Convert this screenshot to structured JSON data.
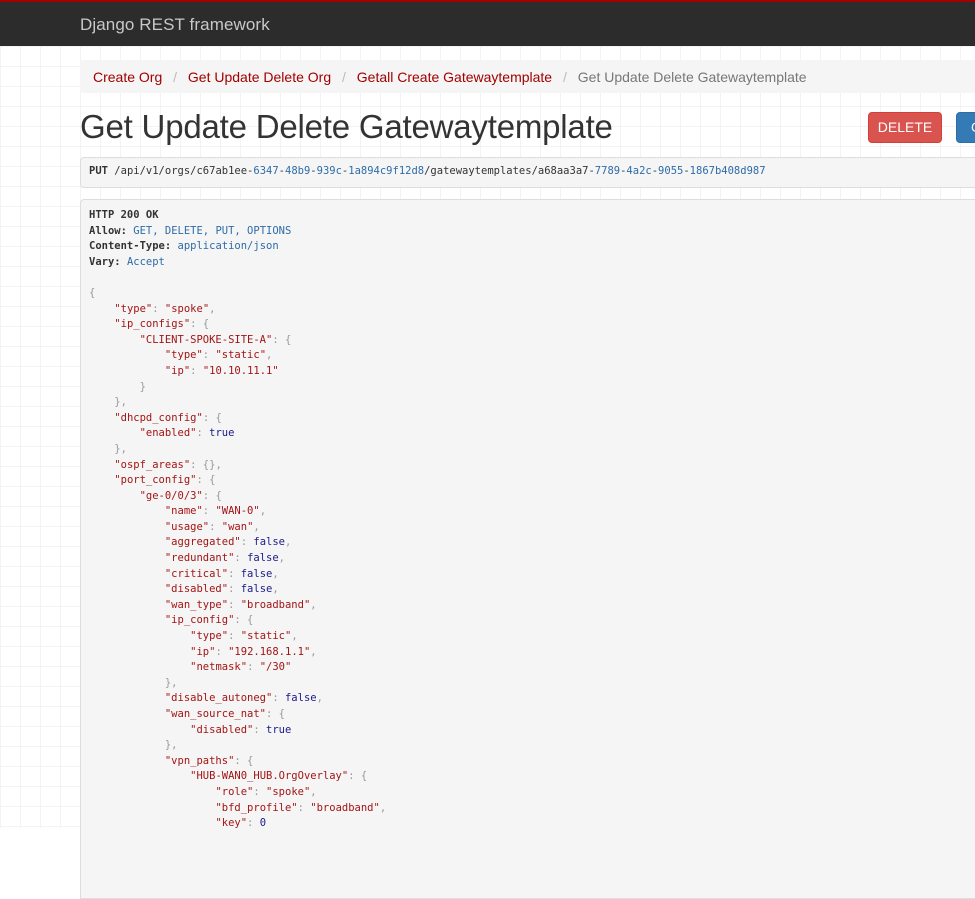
{
  "navbar": {
    "brand": "Django REST framework"
  },
  "breadcrumb": {
    "items": [
      "Create Org",
      "Get Update Delete Org",
      "Getall Create Gatewaytemplate"
    ],
    "active": "Get Update Delete Gatewaytemplate",
    "separator": "/"
  },
  "page": {
    "title": "Get Update Delete Gatewaytemplate"
  },
  "buttons": {
    "delete": "DELETE",
    "options": "O"
  },
  "request": {
    "method": "PUT",
    "path_parts": [
      {
        "t": "/api/v1/orgs/c67ab1ee-",
        "n": false
      },
      {
        "t": "6347",
        "n": true
      },
      {
        "t": "-",
        "n": false
      },
      {
        "t": "48b9",
        "n": true
      },
      {
        "t": "-",
        "n": false
      },
      {
        "t": "939c",
        "n": true
      },
      {
        "t": "-",
        "n": false
      },
      {
        "t": "1a894c9f12d8",
        "n": true
      },
      {
        "t": "/gatewaytemplates/a68aa3a7-",
        "n": false
      },
      {
        "t": "7789",
        "n": true
      },
      {
        "t": "-",
        "n": false
      },
      {
        "t": "4a2c",
        "n": true
      },
      {
        "t": "-",
        "n": false
      },
      {
        "t": "9055",
        "n": true
      },
      {
        "t": "-",
        "n": false
      },
      {
        "t": "1867b408d987",
        "n": true
      }
    ]
  },
  "response": {
    "status": "HTTP 200 OK",
    "headers": [
      {
        "name": "Allow",
        "value": "GET, DELETE, PUT, OPTIONS"
      },
      {
        "name": "Content-Type",
        "value": "application/json"
      },
      {
        "name": "Vary",
        "value": "Accept"
      }
    ],
    "body": [
      {
        "i": 0,
        "t": [
          [
            "p",
            "{"
          ]
        ]
      },
      {
        "i": 1,
        "t": [
          [
            "k",
            "\"type\""
          ],
          [
            "p",
            ": "
          ],
          [
            "s",
            "\"spoke\""
          ],
          [
            "p",
            ","
          ]
        ]
      },
      {
        "i": 1,
        "t": [
          [
            "k",
            "\"ip_configs\""
          ],
          [
            "p",
            ": {"
          ]
        ]
      },
      {
        "i": 2,
        "t": [
          [
            "k",
            "\"CLIENT-SPOKE-SITE-A\""
          ],
          [
            "p",
            ": {"
          ]
        ]
      },
      {
        "i": 3,
        "t": [
          [
            "k",
            "\"type\""
          ],
          [
            "p",
            ": "
          ],
          [
            "s",
            "\"static\""
          ],
          [
            "p",
            ","
          ]
        ]
      },
      {
        "i": 3,
        "t": [
          [
            "k",
            "\"ip\""
          ],
          [
            "p",
            ": "
          ],
          [
            "s",
            "\"10.10.11.1\""
          ]
        ]
      },
      {
        "i": 2,
        "t": [
          [
            "p",
            "}"
          ]
        ]
      },
      {
        "i": 1,
        "t": [
          [
            "p",
            "},"
          ]
        ]
      },
      {
        "i": 1,
        "t": [
          [
            "k",
            "\"dhcpd_config\""
          ],
          [
            "p",
            ": {"
          ]
        ]
      },
      {
        "i": 2,
        "t": [
          [
            "k",
            "\"enabled\""
          ],
          [
            "p",
            ": "
          ],
          [
            "l",
            "true"
          ]
        ]
      },
      {
        "i": 1,
        "t": [
          [
            "p",
            "},"
          ]
        ]
      },
      {
        "i": 1,
        "t": [
          [
            "k",
            "\"ospf_areas\""
          ],
          [
            "p",
            ": {},"
          ]
        ]
      },
      {
        "i": 1,
        "t": [
          [
            "k",
            "\"port_config\""
          ],
          [
            "p",
            ": {"
          ]
        ]
      },
      {
        "i": 2,
        "t": [
          [
            "k",
            "\"ge-0/0/3\""
          ],
          [
            "p",
            ": {"
          ]
        ]
      },
      {
        "i": 3,
        "t": [
          [
            "k",
            "\"name\""
          ],
          [
            "p",
            ": "
          ],
          [
            "s",
            "\"WAN-0\""
          ],
          [
            "p",
            ","
          ]
        ]
      },
      {
        "i": 3,
        "t": [
          [
            "k",
            "\"usage\""
          ],
          [
            "p",
            ": "
          ],
          [
            "s",
            "\"wan\""
          ],
          [
            "p",
            ","
          ]
        ]
      },
      {
        "i": 3,
        "t": [
          [
            "k",
            "\"aggregated\""
          ],
          [
            "p",
            ": "
          ],
          [
            "l",
            "false"
          ],
          [
            "p",
            ","
          ]
        ]
      },
      {
        "i": 3,
        "t": [
          [
            "k",
            "\"redundant\""
          ],
          [
            "p",
            ": "
          ],
          [
            "l",
            "false"
          ],
          [
            "p",
            ","
          ]
        ]
      },
      {
        "i": 3,
        "t": [
          [
            "k",
            "\"critical\""
          ],
          [
            "p",
            ": "
          ],
          [
            "l",
            "false"
          ],
          [
            "p",
            ","
          ]
        ]
      },
      {
        "i": 3,
        "t": [
          [
            "k",
            "\"disabled\""
          ],
          [
            "p",
            ": "
          ],
          [
            "l",
            "false"
          ],
          [
            "p",
            ","
          ]
        ]
      },
      {
        "i": 3,
        "t": [
          [
            "k",
            "\"wan_type\""
          ],
          [
            "p",
            ": "
          ],
          [
            "s",
            "\"broadband\""
          ],
          [
            "p",
            ","
          ]
        ]
      },
      {
        "i": 3,
        "t": [
          [
            "k",
            "\"ip_config\""
          ],
          [
            "p",
            ": {"
          ]
        ]
      },
      {
        "i": 4,
        "t": [
          [
            "k",
            "\"type\""
          ],
          [
            "p",
            ": "
          ],
          [
            "s",
            "\"static\""
          ],
          [
            "p",
            ","
          ]
        ]
      },
      {
        "i": 4,
        "t": [
          [
            "k",
            "\"ip\""
          ],
          [
            "p",
            ": "
          ],
          [
            "s",
            "\"192.168.1.1\""
          ],
          [
            "p",
            ","
          ]
        ]
      },
      {
        "i": 4,
        "t": [
          [
            "k",
            "\"netmask\""
          ],
          [
            "p",
            ": "
          ],
          [
            "s",
            "\"/30\""
          ]
        ]
      },
      {
        "i": 3,
        "t": [
          [
            "p",
            "},"
          ]
        ]
      },
      {
        "i": 3,
        "t": [
          [
            "k",
            "\"disable_autoneg\""
          ],
          [
            "p",
            ": "
          ],
          [
            "l",
            "false"
          ],
          [
            "p",
            ","
          ]
        ]
      },
      {
        "i": 3,
        "t": [
          [
            "k",
            "\"wan_source_nat\""
          ],
          [
            "p",
            ": {"
          ]
        ]
      },
      {
        "i": 4,
        "t": [
          [
            "k",
            "\"disabled\""
          ],
          [
            "p",
            ": "
          ],
          [
            "l",
            "true"
          ]
        ]
      },
      {
        "i": 3,
        "t": [
          [
            "p",
            "},"
          ]
        ]
      },
      {
        "i": 3,
        "t": [
          [
            "k",
            "\"vpn_paths\""
          ],
          [
            "p",
            ": {"
          ]
        ]
      },
      {
        "i": 4,
        "t": [
          [
            "k",
            "\"HUB-WAN0_HUB.OrgOverlay\""
          ],
          [
            "p",
            ": {"
          ]
        ]
      },
      {
        "i": 5,
        "t": [
          [
            "k",
            "\"role\""
          ],
          [
            "p",
            ": "
          ],
          [
            "s",
            "\"spoke\""
          ],
          [
            "p",
            ","
          ]
        ]
      },
      {
        "i": 5,
        "t": [
          [
            "k",
            "\"bfd_profile\""
          ],
          [
            "p",
            ": "
          ],
          [
            "s",
            "\"broadband\""
          ],
          [
            "p",
            ","
          ]
        ]
      },
      {
        "i": 5,
        "t": [
          [
            "k",
            "\"key\""
          ],
          [
            "p",
            ": "
          ],
          [
            "n",
            "0"
          ]
        ]
      }
    ]
  }
}
